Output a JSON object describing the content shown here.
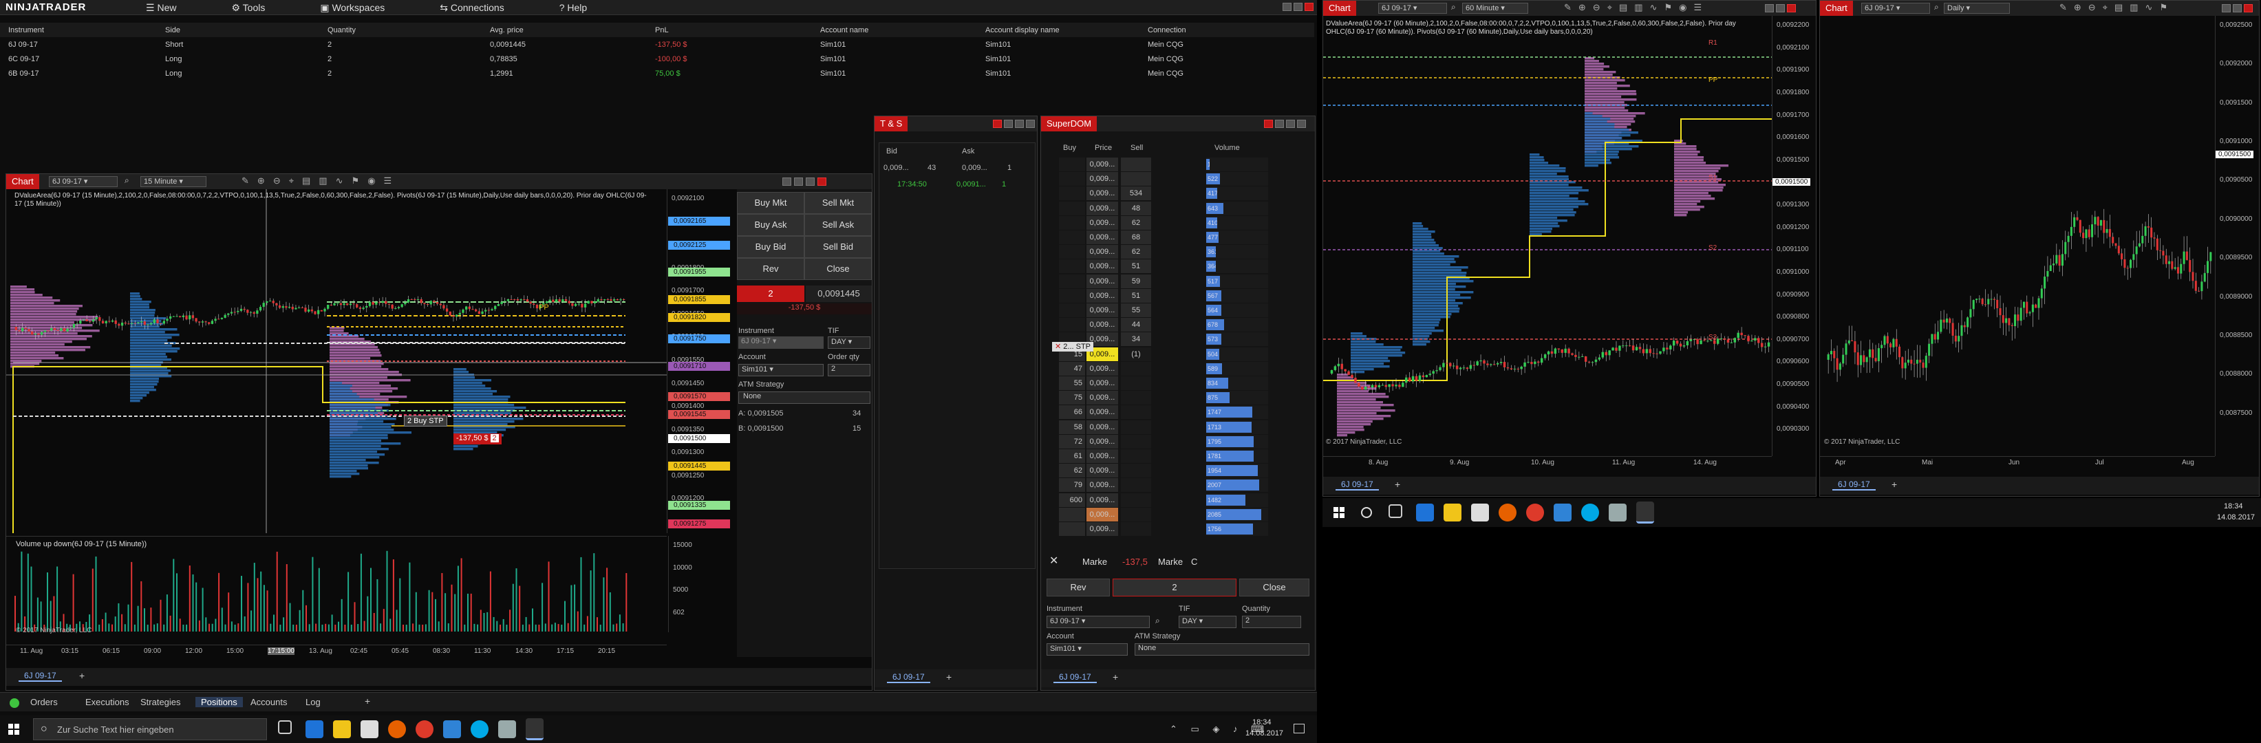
{
  "menu": {
    "logo": "NINJATRADER",
    "items": [
      "New",
      "Tools",
      "Workspaces",
      "Connections",
      "Help"
    ]
  },
  "positions": {
    "headers": [
      "Instrument",
      "Side",
      "Quantity",
      "Avg. price",
      "PnL",
      "Account name",
      "Account display name",
      "Connection"
    ],
    "rows": [
      {
        "instrument": "6J 09-17",
        "side": "Short",
        "qty": "2",
        "avg": "0,0091445",
        "pnl": "-137,50 $",
        "account": "Sim101",
        "display": "Sim101",
        "conn": "Mein CQG",
        "pnl_color": "#e04545"
      },
      {
        "instrument": "6C 09-17",
        "side": "Long",
        "qty": "2",
        "avg": "0,78835",
        "pnl": "-100,00 $",
        "account": "Sim101",
        "display": "Sim101",
        "conn": "Mein CQG",
        "pnl_color": "#e04545"
      },
      {
        "instrument": "6B 09-17",
        "side": "Long",
        "qty": "2",
        "avg": "1,2991",
        "pnl": "75,00 $",
        "account": "Sim101",
        "display": "Sim101",
        "conn": "Mein CQG",
        "pnl_color": "#3fc43f"
      }
    ]
  },
  "chart1": {
    "title": "Chart",
    "instrument": "6J 09-17",
    "interval": "15 Minute",
    "info": "DValueArea(6J 09-17 (15 Minute),2,100,2,0,False,08:00:00,0,7,2,2,VTPO,0,100,1,13,5,True,2,False,0,60,300,False,2,False). Pivots(6J 09-17 (15 Minute),Daily,Use daily bars,0,0,0,20). Prior day OHLC(6J 09-17 (15 Minute))",
    "price_tags": [
      {
        "label": "0,0092165",
        "color": "#4aa3ff"
      },
      {
        "label": "0,0092125",
        "color": "#4aa3ff"
      },
      {
        "label": "0,0091955",
        "color": "#8fe38f"
      },
      {
        "label": "0,0091855",
        "color": "#f0c419"
      },
      {
        "label": "0,0091820",
        "color": "#f0c419"
      },
      {
        "label": "0,0091750",
        "color": "#4aa3ff"
      },
      {
        "label": "0,0091710",
        "color": "#9b59b6"
      },
      {
        "label": "0,0091570",
        "color": "#e05050"
      },
      {
        "label": "0,0091545",
        "color": "#e05050"
      },
      {
        "label": "0,0091500",
        "color": "#ffffff"
      },
      {
        "label": "0,0091445",
        "color": "#f0c419"
      },
      {
        "label": "0,0091335",
        "color": "#8fe38f"
      },
      {
        "label": "0,0091275",
        "color": "#e0365a"
      }
    ],
    "y_ticks": [
      "0,0092100",
      "0,0092000",
      "0,0091900",
      "0,0091800",
      "0,0091700",
      "0,0091650",
      "0,0091600",
      "0,0091550",
      "0,0091450",
      "0,0091400",
      "0,0091350",
      "0,0091300",
      "0,0091250",
      "0,0091200"
    ],
    "pp_label": "PP",
    "x_ticks": [
      "11. Aug",
      "03:15",
      "06:15",
      "09:00",
      "12:00",
      "15:00",
      "17:15:00",
      "13. Aug",
      "02:45",
      "05:45",
      "08:30",
      "11:30",
      "14:30",
      "17:15",
      "20:15"
    ],
    "volume_title": "Volume up down(6J 09-17 (15 Minute))",
    "volume_ticks": [
      "15000",
      "10000",
      "5000",
      "602"
    ],
    "copyright": "© 2017 NinjaTrader, LLC",
    "order_label": "2  Buy STP",
    "pnl_label": "-137,50 $",
    "pnl_qty": "2",
    "tab": "6J 09-17"
  },
  "chart_trader": {
    "buttons": [
      "Buy Mkt",
      "Sell Mkt",
      "Buy Ask",
      "Sell Ask",
      "Buy Bid",
      "Sell Bid",
      "Rev",
      "Close"
    ],
    "position_qty": "2",
    "position_price": "0,0091445",
    "pnl": "-137,50 $",
    "instrument_label": "Instrument",
    "instrument": "6J 09-17",
    "tif_label": "TIF",
    "tif": "DAY",
    "account_label": "Account",
    "account": "Sim101",
    "qty_label": "Order qty",
    "qty": "2",
    "atm_label": "ATM Strategy",
    "atm": "None",
    "ask": "A: 0,0091505",
    "ask_size": "34",
    "bid": "B: 0,0091500",
    "bid_size": "15"
  },
  "ts": {
    "title": "T & S",
    "headers": [
      "Bid",
      "Ask"
    ],
    "row1": [
      "0,009...",
      "43",
      "0,009...",
      "1"
    ],
    "row2": [
      "17:34:50",
      "0,0091...",
      "1"
    ],
    "tab": "6J 09-17"
  },
  "superdom": {
    "title": "SuperDOM",
    "headers": [
      "Buy",
      "Price",
      "Sell",
      "Volume"
    ],
    "rows": [
      {
        "buy": "",
        "price": "0,009...",
        "sell": "",
        "vol": "138"
      },
      {
        "buy": "",
        "price": "0,009...",
        "sell": "",
        "vol": "522"
      },
      {
        "buy": "",
        "price": "0,009...",
        "sell": "534",
        "vol": "417"
      },
      {
        "buy": "",
        "price": "0,009...",
        "sell": "48",
        "vol": "643"
      },
      {
        "buy": "",
        "price": "0,009...",
        "sell": "62",
        "vol": "410"
      },
      {
        "buy": "",
        "price": "0,009...",
        "sell": "68",
        "vol": "477"
      },
      {
        "buy": "",
        "price": "0,009...",
        "sell": "62",
        "vol": "361"
      },
      {
        "buy": "",
        "price": "0,009...",
        "sell": "51",
        "vol": "364"
      },
      {
        "buy": "",
        "price": "0,009...",
        "sell": "59",
        "vol": "517"
      },
      {
        "buy": "",
        "price": "0,009...",
        "sell": "51",
        "vol": "567"
      },
      {
        "buy": "",
        "price": "0,009...",
        "sell": "55",
        "vol": "564"
      },
      {
        "buy": "",
        "price": "0,009...",
        "sell": "44",
        "vol": "678"
      },
      {
        "buy": "",
        "price": "0,009...",
        "sell": "34",
        "vol": "573"
      },
      {
        "buy": "15",
        "price": "0,009...",
        "sell": "(1)",
        "vol": "504"
      },
      {
        "buy": "47",
        "price": "0,009...",
        "sell": "",
        "vol": "589"
      },
      {
        "buy": "55",
        "price": "0,009...",
        "sell": "",
        "vol": "834"
      },
      {
        "buy": "75",
        "price": "0,009...",
        "sell": "",
        "vol": "875"
      },
      {
        "buy": "66",
        "price": "0,009...",
        "sell": "",
        "vol": "1747"
      },
      {
        "buy": "58",
        "price": "0,009...",
        "sell": "",
        "vol": "1713"
      },
      {
        "buy": "72",
        "price": "0,009...",
        "sell": "",
        "vol": "1795"
      },
      {
        "buy": "61",
        "price": "0,009...",
        "sell": "",
        "vol": "1781"
      },
      {
        "buy": "62",
        "price": "0,009...",
        "sell": "",
        "vol": "1954"
      },
      {
        "buy": "79",
        "price": "0,009...",
        "sell": "",
        "vol": "2007"
      },
      {
        "buy": "600",
        "price": "0,009...",
        "sell": "",
        "vol": "1482"
      },
      {
        "buy": "",
        "price": "0,009...",
        "sell": "",
        "vol": "2085"
      },
      {
        "buy": "",
        "price": "0,009...",
        "sell": "",
        "vol": "1756"
      }
    ],
    "stop_order": "2... STP",
    "market_left": "Marke",
    "pnl": "-137,5",
    "market_right": "Marke",
    "c_label": "C",
    "rev": "Rev",
    "qty": "2",
    "close": "Close",
    "instrument_label": "Instrument",
    "instrument": "6J 09-17",
    "tif_label": "TIF",
    "tif": "DAY",
    "quantity_label": "Quantity",
    "quantity": "2",
    "account_label": "Account",
    "account": "Sim101",
    "atm_label": "ATM Strategy",
    "atm": "None",
    "tab": "6J 09-17"
  },
  "chart2": {
    "title": "Chart",
    "instrument": "6J 09-17",
    "interval": "60 Minute",
    "info": "DValueArea(6J 09-17 (60 Minute),2,100,2,0,False,08:00:00,0,7,2,2,VTPO,0,100,1,13,5,True,2,False,0,60,300,False,2,False). Prior day OHLC(6J 09-17 (60 Minute)). Pivots(6J 09-17 (60 Minute),Daily,Use daily bars,0,0,0,20)",
    "y_ticks": [
      "0,0092200",
      "0,0092100",
      "0,0091900",
      "0,0091800",
      "0,0091700",
      "0,0091600",
      "0,0091500",
      "0,0091400",
      "0,0091300",
      "0,0091200",
      "0,0091100",
      "0,0091000",
      "0,0090900",
      "0,0090800",
      "0,0090700",
      "0,0090600",
      "0,0090500",
      "0,0090400",
      "0,0090300"
    ],
    "x_ticks": [
      "8. Aug",
      "9. Aug",
      "10. Aug",
      "11. Aug",
      "14. Aug"
    ],
    "current_price": "0,0091500",
    "labels": [
      "R1",
      "PP",
      "S1",
      "S2",
      "S3"
    ],
    "copyright": "© 2017 NinjaTrader, LLC",
    "tab": "6J 09-17"
  },
  "chart3": {
    "title": "Chart",
    "instrument": "6J 09-17",
    "interval": "Daily",
    "y_ticks": [
      "0,0092500",
      "0,0092000",
      "0,0091500",
      "0,0091000",
      "0,0090500",
      "0,0090000",
      "0,0089500",
      "0,0089000",
      "0,0088500",
      "0,0088000",
      "0,0087500"
    ],
    "x_ticks": [
      "Apr",
      "Mai",
      "Jun",
      "Jul",
      "Aug"
    ],
    "current_price": "0,0091500",
    "copyright": "© 2017 NinjaTrader, LLC",
    "tab": "6J 09-17"
  },
  "bottom_tabs": [
    "Orders",
    "Executions",
    "Strategies",
    "Positions",
    "Accounts",
    "Log"
  ],
  "taskbar": {
    "search_placeholder": "Zur Suche Text hier eingeben",
    "time": "18:34",
    "date": "14.08.2017"
  }
}
